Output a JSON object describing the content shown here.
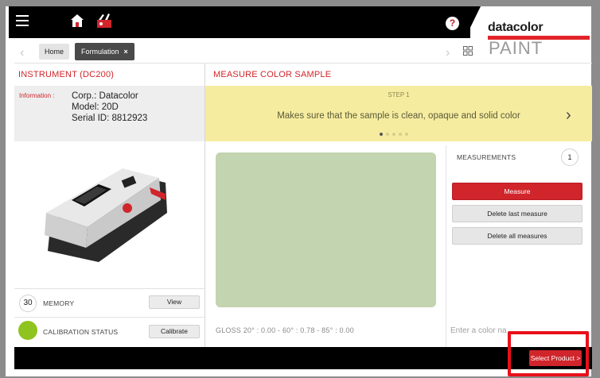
{
  "header": {
    "logo_brand": "datacolor",
    "logo_product": "PAINT",
    "help_label": "?"
  },
  "breadcrumb": {
    "home": "Home",
    "current": "Formulation",
    "close_glyph": "×"
  },
  "instrument": {
    "title": "INSTRUMENT (DC200)",
    "info_label": "Information :",
    "corp": "Corp.: Datacolor",
    "model": "Model: 20D",
    "serial": "Serial ID: 8812923",
    "memory_count": "30",
    "memory_label": "MEMORY",
    "view_label": "View",
    "calibration_label": "CALIBRATION STATUS",
    "calibrate_label": "Calibrate",
    "calibration_color": "#8fc31f"
  },
  "measure": {
    "title": "MEASURE COLOR SAMPLE",
    "step_title": "STEP 1",
    "step_text": "Makes sure that the sample is clean, opaque and solid color",
    "step_count": 5,
    "active_step": 1,
    "sample_color": "#c2d4b0",
    "gloss": "GLOSS   20° : 0.00  -  60° : 0.78  -  85° : 0.00"
  },
  "measurements": {
    "title": "MEASUREMENTS",
    "count": "1",
    "measure_label": "Measure",
    "delete_last_label": "Delete last measure",
    "delete_all_label": "Delete all measures",
    "color_placeholder": "Enter a color na"
  },
  "footer": {
    "select_product_label": "Select Product >"
  },
  "colors": {
    "accent": "#d0252b",
    "step_banner": "#f6eca0",
    "highlight": "#e8101a"
  }
}
